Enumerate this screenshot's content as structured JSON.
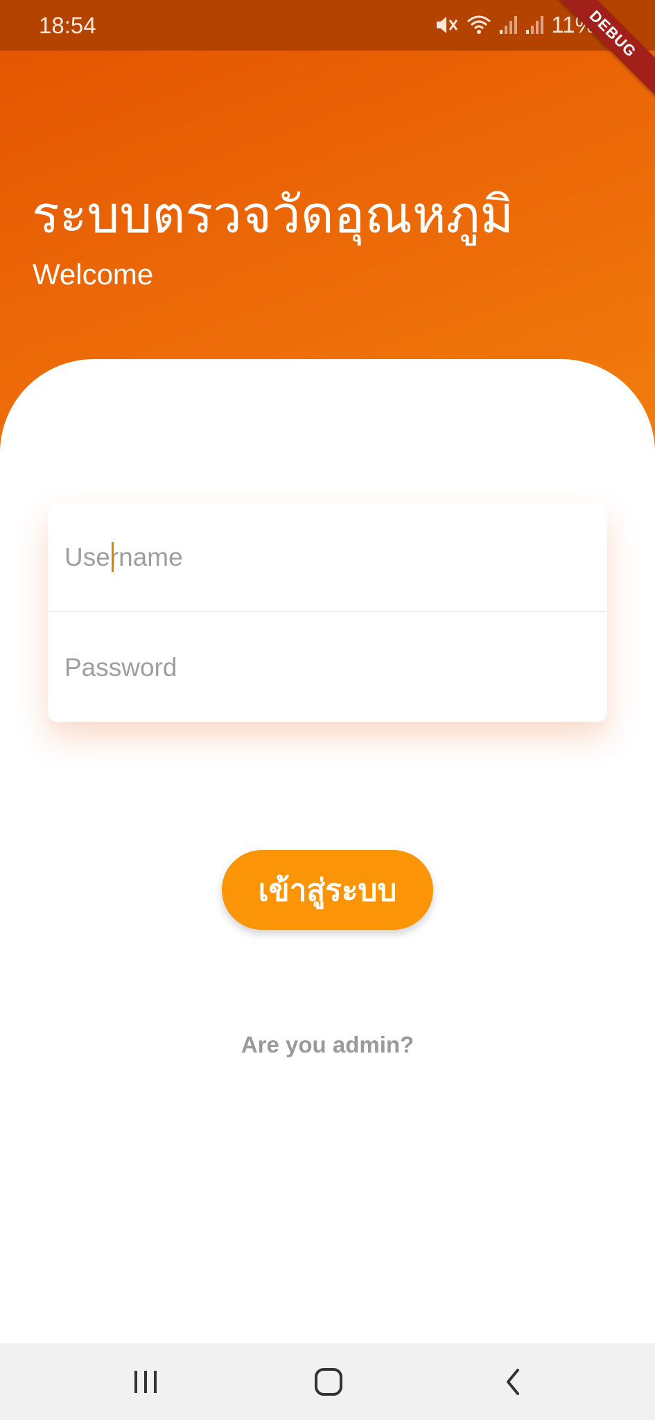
{
  "status_bar": {
    "time": "18:54",
    "battery": "11%",
    "icons": [
      "mute-icon",
      "wifi-icon",
      "signal-icon",
      "signal-icon",
      "battery-icon"
    ]
  },
  "debug_banner": "DEBUG",
  "header": {
    "title": "ระบบตรวจวัดอุณหภูมิ",
    "subtitle": "Welcome"
  },
  "login_form": {
    "username_placeholder": "Username",
    "username_value": "",
    "password_placeholder": "Password",
    "password_value": ""
  },
  "login_button": {
    "label": "เข้าสู่ระบบ"
  },
  "admin_link": {
    "label": "Are you  admin?"
  },
  "nav_bar": {
    "buttons": [
      "recents-icon",
      "home-icon",
      "back-icon"
    ]
  },
  "colors": {
    "status_bar": "#b54300",
    "header_gradient_start": "#e35300",
    "header_gradient_end": "#f3820f",
    "button": "#fb9406",
    "caret": "#e08000",
    "debug_banner": "#a1201a"
  }
}
